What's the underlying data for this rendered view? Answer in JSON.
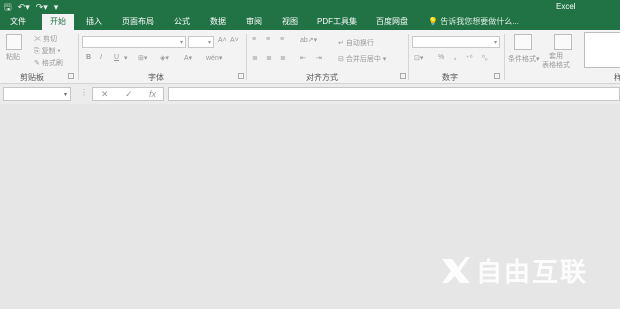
{
  "titlebar": {
    "app_name": "Excel",
    "qat": {
      "save_icon": "save-icon",
      "undo_icon": "undo-icon",
      "redo_icon": "redo-icon",
      "customize_icon": "chevron-down-icon"
    }
  },
  "tabs": [
    {
      "label": "文件"
    },
    {
      "label": "开始"
    },
    {
      "label": "插入"
    },
    {
      "label": "页面布局"
    },
    {
      "label": "公式"
    },
    {
      "label": "数据"
    },
    {
      "label": "审阅"
    },
    {
      "label": "视图"
    },
    {
      "label": "PDF工具集"
    },
    {
      "label": "百度网盘"
    }
  ],
  "tell_me": {
    "placeholder": "告诉我您想要做什么..."
  },
  "ribbon": {
    "clipboard": {
      "paste": "粘贴",
      "cut": "剪切",
      "copy": "复制",
      "format_painter": "格式刷",
      "label": "剪贴板"
    },
    "font": {
      "bold": "B",
      "italic": "I",
      "underline": "U",
      "grow": "A˄",
      "shrink": "A˅",
      "font_color": "A",
      "wen": "wén",
      "label": "字体"
    },
    "alignment": {
      "wrap_text": "自动换行",
      "merge_center": "合并后居中",
      "label": "对齐方式"
    },
    "number": {
      "percent": "%",
      "comma": ",",
      "label": "数字"
    },
    "styles": {
      "conditional_format": "条件格式",
      "format_as_table": "套用\n表格格式"
    },
    "partial_label": "样"
  },
  "formula_bar": {
    "cancel": "✕",
    "enter": "✓",
    "fx": "fx"
  },
  "watermark": {
    "text": "自由互联"
  },
  "colors": {
    "brand": "#217346",
    "workspace": "#e6e6e6",
    "ribbon": "#f3f3f3"
  }
}
